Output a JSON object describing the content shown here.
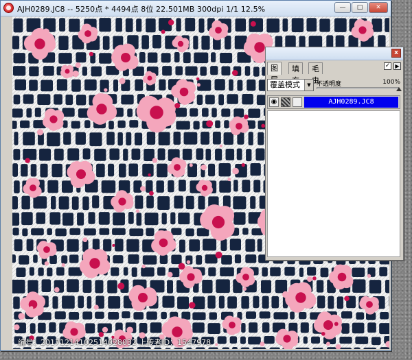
{
  "window": {
    "title": "AJH0289.JC8 -- 5250点 * 4494点 8位  22.501MB 300dpi 1/1   12.5%",
    "minimize_label": "—",
    "maximize_label": "□",
    "close_label": "✕"
  },
  "canvas": {
    "watermark": "编号：20171214102514028032 上传者ID：1547978",
    "colors": {
      "background": "#15243f",
      "grid": "#f2f2f2",
      "flower_pink": "#f4a6bc",
      "flower_magenta": "#c8104e"
    }
  },
  "layers_panel": {
    "close_label": "x",
    "tabs": [
      {
        "label": "图层",
        "active": true
      },
      {
        "label": "填充",
        "active": false
      },
      {
        "label": "毛虫",
        "active": false
      }
    ],
    "check_label": "✓",
    "menu_label": "▶",
    "blend_mode": "覆盖模式",
    "opacity_label": "不透明度",
    "opacity_value": "100%",
    "opacity_level": 1.0,
    "layers": [
      {
        "name": "AJH0289.JC8",
        "visible": true,
        "selected": true
      }
    ],
    "icons": {
      "eye": "eye-icon",
      "dropdown": "chevron-down-icon"
    }
  }
}
